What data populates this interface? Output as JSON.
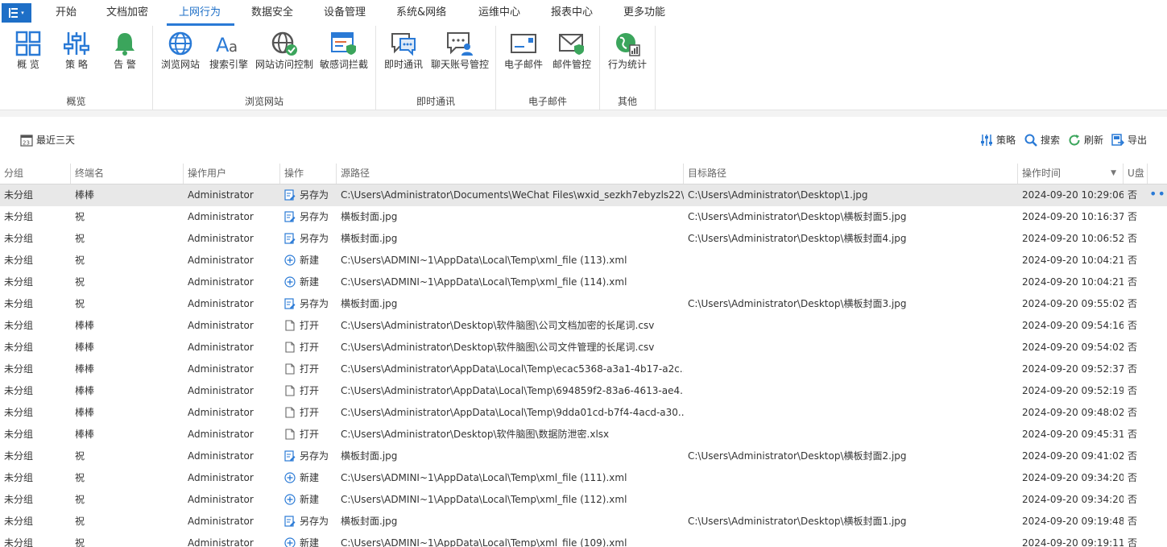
{
  "menu": {
    "tabs": [
      "开始",
      "文档加密",
      "上网行为",
      "数据安全",
      "设备管理",
      "系统&网络",
      "运维中心",
      "报表中心",
      "更多功能"
    ],
    "active_tab": "上网行为"
  },
  "ribbon": {
    "groups": [
      {
        "label": "概览",
        "buttons": [
          {
            "label": "概 览",
            "icon": "overview-grid-icon"
          },
          {
            "label": "策 略",
            "icon": "policy-sliders-icon"
          },
          {
            "label": "告 警",
            "icon": "alert-bell-icon"
          }
        ]
      },
      {
        "label": "浏览网站",
        "buttons": [
          {
            "label": "浏览网站",
            "icon": "globe-icon"
          },
          {
            "label": "搜索引擎",
            "icon": "search-engine-aa-icon"
          },
          {
            "label": "网站访问控制",
            "icon": "globe-check-icon"
          },
          {
            "label": "敏感词拦截",
            "icon": "browser-shield-icon"
          }
        ]
      },
      {
        "label": "即时通讯",
        "buttons": [
          {
            "label": "即时通讯",
            "icon": "chat-bubble-icon"
          },
          {
            "label": "聊天账号管控",
            "icon": "chat-user-icon"
          }
        ]
      },
      {
        "label": "电子邮件",
        "buttons": [
          {
            "label": "电子邮件",
            "icon": "mail-icon"
          },
          {
            "label": "邮件管控",
            "icon": "mail-shield-icon"
          }
        ]
      },
      {
        "label": "其他",
        "buttons": [
          {
            "label": "行为统计",
            "icon": "behavior-stats-icon"
          }
        ]
      }
    ]
  },
  "toolbar": {
    "date_range": "最近三天",
    "date_icon_text": "23",
    "policy": "策略",
    "search": "搜索",
    "refresh": "刷新",
    "export": "导出"
  },
  "table": {
    "columns": [
      "分组",
      "终端名",
      "操作用户",
      "操作",
      "源路径",
      "目标路径",
      "操作时间",
      "U盘"
    ],
    "sort_column": "操作时间",
    "rows": [
      {
        "group": "未分组",
        "terminal": "棒棒",
        "user": "Administrator",
        "op": "另存为",
        "op_icon": "save-as",
        "src": "C:\\Users\\Administrator\\Documents\\WeChat Files\\wxid_sezkh7ebyzls22\\...",
        "dst": "C:\\Users\\Administrator\\Desktop\\1.jpg",
        "time": "2024-09-20 10:29:06",
        "usb": "否"
      },
      {
        "group": "未分组",
        "terminal": "祝",
        "user": "Administrator",
        "op": "另存为",
        "op_icon": "save-as",
        "src": "横板封面.jpg",
        "dst": "C:\\Users\\Administrator\\Desktop\\横板封面5.jpg",
        "time": "2024-09-20 10:16:37",
        "usb": "否"
      },
      {
        "group": "未分组",
        "terminal": "祝",
        "user": "Administrator",
        "op": "另存为",
        "op_icon": "save-as",
        "src": "横板封面.jpg",
        "dst": "C:\\Users\\Administrator\\Desktop\\横板封面4.jpg",
        "time": "2024-09-20 10:06:52",
        "usb": "否"
      },
      {
        "group": "未分组",
        "terminal": "祝",
        "user": "Administrator",
        "op": "新建",
        "op_icon": "new",
        "src": "C:\\Users\\ADMINI~1\\AppData\\Local\\Temp\\xml_file (113).xml",
        "dst": "",
        "time": "2024-09-20 10:04:21",
        "usb": "否"
      },
      {
        "group": "未分组",
        "terminal": "祝",
        "user": "Administrator",
        "op": "新建",
        "op_icon": "new",
        "src": "C:\\Users\\ADMINI~1\\AppData\\Local\\Temp\\xml_file (114).xml",
        "dst": "",
        "time": "2024-09-20 10:04:21",
        "usb": "否"
      },
      {
        "group": "未分组",
        "terminal": "祝",
        "user": "Administrator",
        "op": "另存为",
        "op_icon": "save-as",
        "src": "横板封面.jpg",
        "dst": "C:\\Users\\Administrator\\Desktop\\横板封面3.jpg",
        "time": "2024-09-20 09:55:02",
        "usb": "否"
      },
      {
        "group": "未分组",
        "terminal": "棒棒",
        "user": "Administrator",
        "op": "打开",
        "op_icon": "open",
        "src": "C:\\Users\\Administrator\\Desktop\\软件脑图\\公司文档加密的长尾词.csv",
        "dst": "",
        "time": "2024-09-20 09:54:16",
        "usb": "否"
      },
      {
        "group": "未分组",
        "terminal": "棒棒",
        "user": "Administrator",
        "op": "打开",
        "op_icon": "open",
        "src": "C:\\Users\\Administrator\\Desktop\\软件脑图\\公司文件管理的长尾词.csv",
        "dst": "",
        "time": "2024-09-20 09:54:02",
        "usb": "否"
      },
      {
        "group": "未分组",
        "terminal": "棒棒",
        "user": "Administrator",
        "op": "打开",
        "op_icon": "open",
        "src": "C:\\Users\\Administrator\\AppData\\Local\\Temp\\ecac5368-a3a1-4b17-a2c...",
        "dst": "",
        "time": "2024-09-20 09:52:37",
        "usb": "否"
      },
      {
        "group": "未分组",
        "terminal": "棒棒",
        "user": "Administrator",
        "op": "打开",
        "op_icon": "open",
        "src": "C:\\Users\\Administrator\\AppData\\Local\\Temp\\694859f2-83a6-4613-ae4...",
        "dst": "",
        "time": "2024-09-20 09:52:19",
        "usb": "否"
      },
      {
        "group": "未分组",
        "terminal": "棒棒",
        "user": "Administrator",
        "op": "打开",
        "op_icon": "open",
        "src": "C:\\Users\\Administrator\\AppData\\Local\\Temp\\9dda01cd-b7f4-4acd-a30...",
        "dst": "",
        "time": "2024-09-20 09:48:02",
        "usb": "否"
      },
      {
        "group": "未分组",
        "terminal": "棒棒",
        "user": "Administrator",
        "op": "打开",
        "op_icon": "open",
        "src": "C:\\Users\\Administrator\\Desktop\\软件脑图\\数据防泄密.xlsx",
        "dst": "",
        "time": "2024-09-20 09:45:31",
        "usb": "否"
      },
      {
        "group": "未分组",
        "terminal": "祝",
        "user": "Administrator",
        "op": "另存为",
        "op_icon": "save-as",
        "src": "横板封面.jpg",
        "dst": "C:\\Users\\Administrator\\Desktop\\横板封面2.jpg",
        "time": "2024-09-20 09:41:02",
        "usb": "否"
      },
      {
        "group": "未分组",
        "terminal": "祝",
        "user": "Administrator",
        "op": "新建",
        "op_icon": "new",
        "src": "C:\\Users\\ADMINI~1\\AppData\\Local\\Temp\\xml_file (111).xml",
        "dst": "",
        "time": "2024-09-20 09:34:20",
        "usb": "否"
      },
      {
        "group": "未分组",
        "terminal": "祝",
        "user": "Administrator",
        "op": "新建",
        "op_icon": "new",
        "src": "C:\\Users\\ADMINI~1\\AppData\\Local\\Temp\\xml_file (112).xml",
        "dst": "",
        "time": "2024-09-20 09:34:20",
        "usb": "否"
      },
      {
        "group": "未分组",
        "terminal": "祝",
        "user": "Administrator",
        "op": "另存为",
        "op_icon": "save-as",
        "src": "横板封面.jpg",
        "dst": "C:\\Users\\Administrator\\Desktop\\横板封面1.jpg",
        "time": "2024-09-20 09:19:48",
        "usb": "否"
      },
      {
        "group": "未分组",
        "terminal": "祝",
        "user": "Administrator",
        "op": "新建",
        "op_icon": "new",
        "src": "C:\\Users\\ADMINI~1\\AppData\\Local\\Temp\\xml_file (109).xml",
        "dst": "",
        "time": "2024-09-20 09:19:11",
        "usb": "否"
      }
    ],
    "row_more_icon": "more-dots-icon"
  },
  "colors": {
    "accent": "#1e6fc7",
    "selected_row": "#e8e8e8",
    "icon_green": "#3ba55c"
  }
}
